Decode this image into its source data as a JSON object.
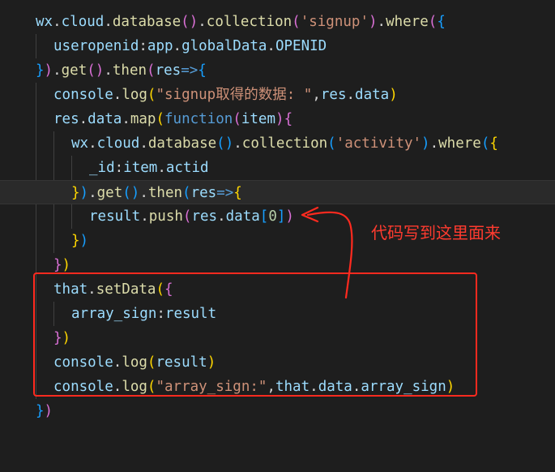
{
  "editor": {
    "lines": [
      "wx.cloud.database().collection('signup').where({",
      "useropenid:app.globalData.OPENID",
      "}).get().then(res=>{",
      "console.log(\"signup取得的数据: \",res.data)",
      "res.data.map(function(item){",
      "wx.cloud.database().collection('activity').where({",
      "_id:item.actid",
      "}).get().then(res=>{",
      "result.push(res.data[0])",
      "})",
      "})",
      "that.setData({",
      "array_sign:result",
      "})",
      "console.log(result)",
      "console.log(\"array_sign:\",that.data.array_sign)",
      "})"
    ]
  },
  "annotation": {
    "text": "代码写到这里面来"
  },
  "colors": {
    "background": "#1e1e1e",
    "annotation_red": "#ff2a1f"
  }
}
